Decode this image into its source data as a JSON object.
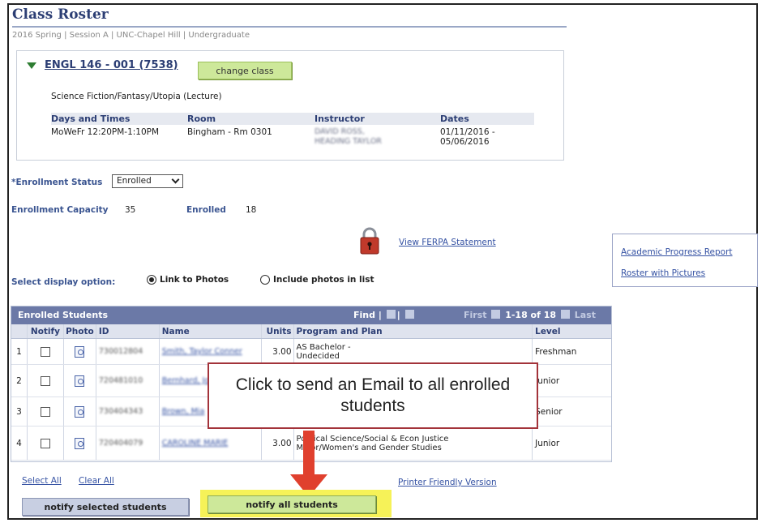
{
  "page": {
    "title": "Class Roster",
    "subtitle": "2016 Spring | Session A | UNC-Chapel Hill | Undergraduate"
  },
  "class_info": {
    "class_link": "ENGL 146 - 001 (7538)",
    "change_class_button": "change class",
    "description": "Science Fiction/Fantasy/Utopia (Lecture)",
    "headers": [
      "Days and Times",
      "Room",
      "Instructor",
      "Dates"
    ],
    "row": {
      "days_times": "MoWeFr 12:20PM-1:10PM",
      "room": "Bingham - Rm 0301",
      "instructor_line1": "DAVID ROSS,",
      "instructor_line2": "HEADING TAYLOR",
      "dates_line1": "01/11/2016 -",
      "dates_line2": "05/06/2016"
    }
  },
  "enrollment": {
    "status_label": "*Enrollment Status",
    "status_value": "Enrolled",
    "capacity_label": "Enrollment Capacity",
    "capacity_value": "35",
    "enrolled_label": "Enrolled",
    "enrolled_value": "18"
  },
  "ferpa": {
    "link": "View FERPA Statement",
    "lock_color": "#c0392b"
  },
  "side_links": {
    "academic_progress": "Academic Progress Report",
    "roster_with_pictures": "Roster with Pictures"
  },
  "display_option": {
    "label": "Select display option:",
    "option1": "Link to Photos",
    "option2": "Include photos in list",
    "selected": "Link to Photos"
  },
  "grid": {
    "title": "Enrolled Students",
    "find": "Find |",
    "nav_first": "First",
    "nav_range": "1-18 of 18",
    "nav_last": "Last",
    "columns": [
      "Notify",
      "Photo",
      "ID",
      "Name",
      "Units",
      "Program and Plan",
      "Level"
    ],
    "rows": [
      {
        "idx": "1",
        "id": "730012804",
        "name": "Smith, Taylor Conner",
        "units": "3.00",
        "program_line1": "AS Bachelor -",
        "program_line2": "Undecided",
        "level": "Freshman"
      },
      {
        "idx": "2",
        "id": "720481010",
        "name": "Bernhard, Jonathan Mark",
        "units": "",
        "program_line1": "",
        "program_line2": "",
        "level": "Junior"
      },
      {
        "idx": "3",
        "id": "730404343",
        "name": "Brown, Mia",
        "units": "",
        "program_line1": "",
        "program_line2": "",
        "level": "Senior"
      },
      {
        "idx": "4",
        "id": "720404079",
        "name": "CAROLINE MARIE",
        "units": "3.00",
        "program_line1": "Political Science/Social & Econ Justice",
        "program_line2": "Minor/Women's and Gender Studies",
        "level": "Junior"
      }
    ]
  },
  "callout": {
    "text": "Click to send an Email to all enrolled students",
    "border_color": "#a3333a",
    "arrow_color": "#e0402e"
  },
  "footer": {
    "select_all": "Select All",
    "clear_all": "Clear All",
    "printer_friendly": "Printer Friendly Version",
    "notify_selected": "notify selected students",
    "notify_all": "notify all students",
    "highlight_color": "#f6f258"
  }
}
